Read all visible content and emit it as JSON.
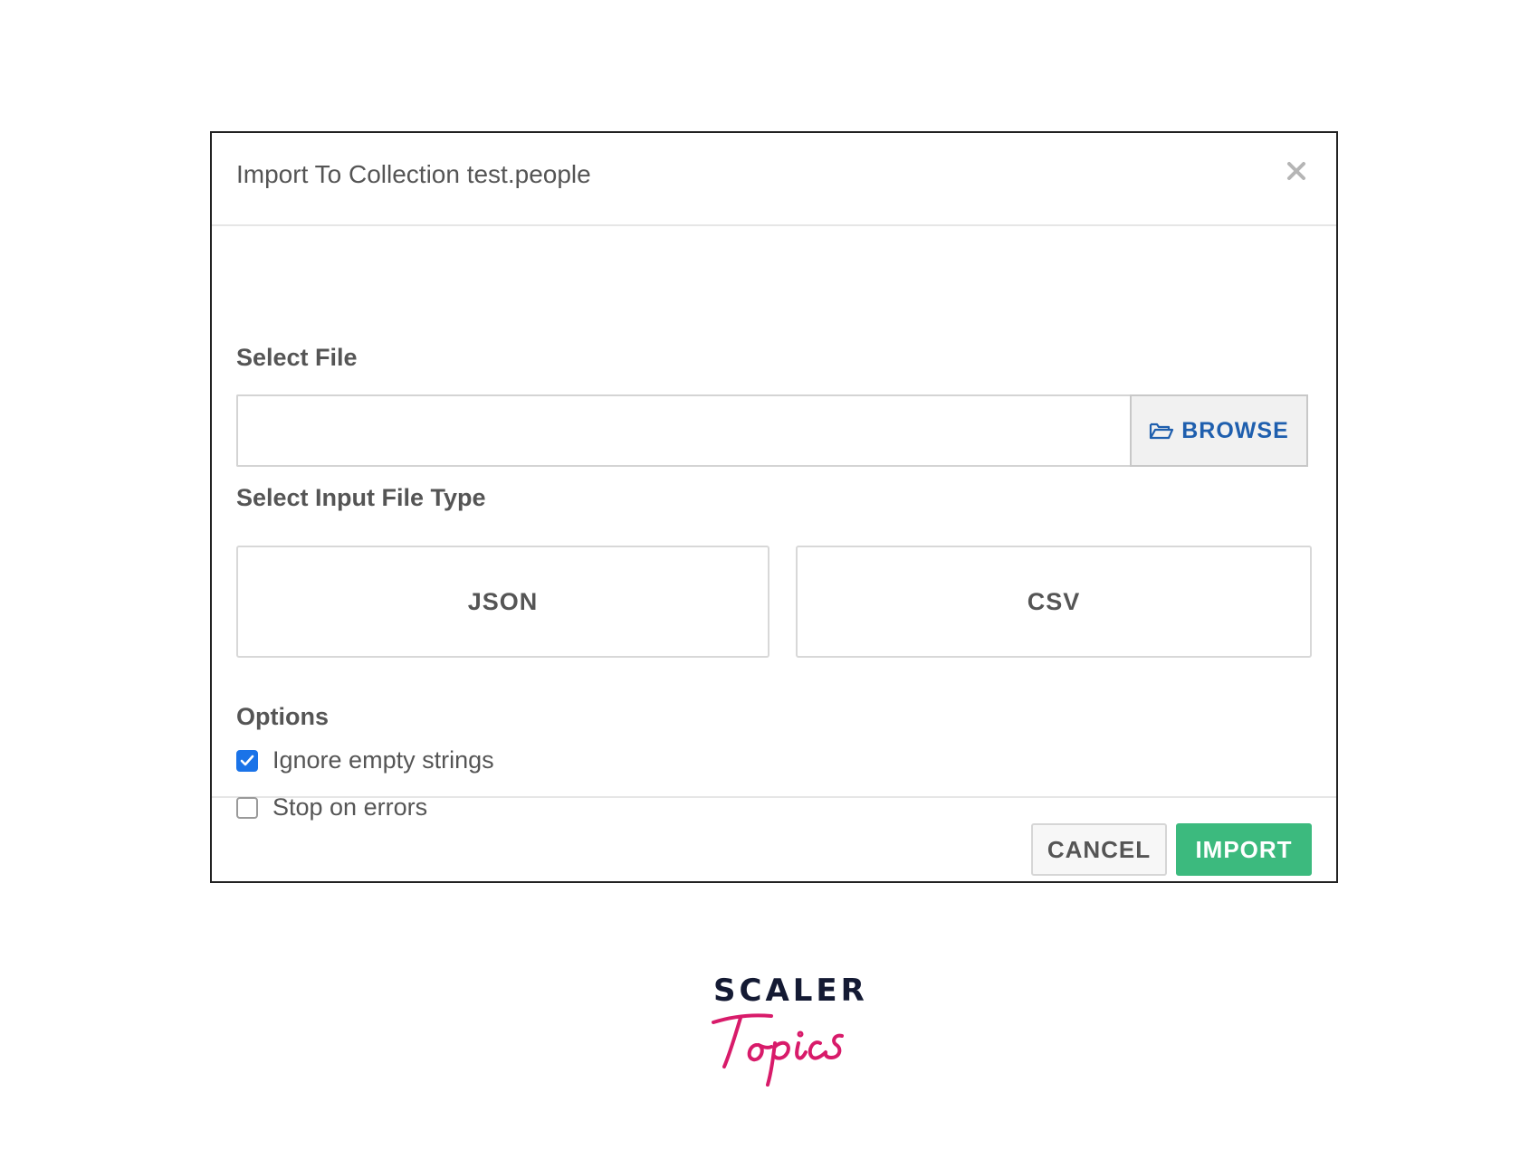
{
  "dialog": {
    "title": "Import To Collection test.people",
    "close_icon": "close-icon"
  },
  "select_file": {
    "label": "Select File",
    "input_value": "",
    "browse_label": "BROWSE",
    "browse_icon": "folder-open-icon",
    "accent_color": "#1f5fae"
  },
  "file_type": {
    "label": "Select Input File Type",
    "options": [
      "JSON",
      "CSV"
    ]
  },
  "options": {
    "label": "Options",
    "items": [
      {
        "label": "Ignore empty strings",
        "checked": true
      },
      {
        "label": "Stop on errors",
        "checked": false
      }
    ]
  },
  "footer": {
    "cancel_label": "CANCEL",
    "import_label": "IMPORT",
    "import_color": "#3cba7e"
  },
  "branding": {
    "name": "SCALER",
    "script": "Topics",
    "accent_color": "#d81b6a"
  }
}
